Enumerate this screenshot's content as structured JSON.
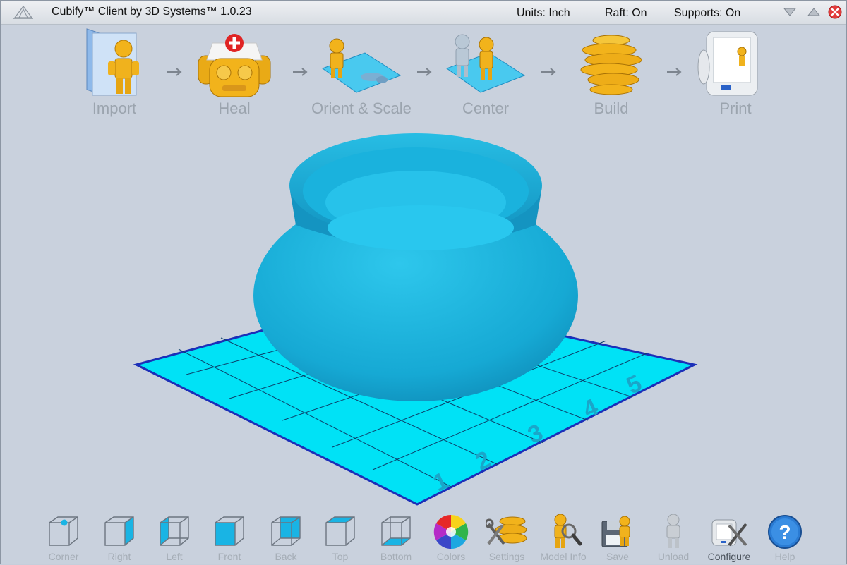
{
  "window": {
    "title": "Cubify™ Client by 3D Systems™ 1.0.23",
    "units": "Units: Inch",
    "raft": "Raft: On",
    "supports": "Supports: On"
  },
  "workflow": {
    "steps": [
      {
        "label": "Import"
      },
      {
        "label": "Heal"
      },
      {
        "label": "Orient & Scale"
      },
      {
        "label": "Center"
      },
      {
        "label": "Build"
      },
      {
        "label": "Print"
      }
    ]
  },
  "build_plate": {
    "grid_numbers": [
      "1",
      "2",
      "3",
      "4",
      "5"
    ],
    "colors": {
      "plate": "#00e1f5",
      "model": "#1ab0d8",
      "grid_line": "#0b3f6a"
    }
  },
  "toolbar": {
    "views": [
      "Corner",
      "Right",
      "Left",
      "Front",
      "Back",
      "Top",
      "Bottom"
    ],
    "actions": [
      "Colors",
      "Settings",
      "Model Info",
      "Save",
      "Unload",
      "Configure",
      "Help"
    ]
  }
}
